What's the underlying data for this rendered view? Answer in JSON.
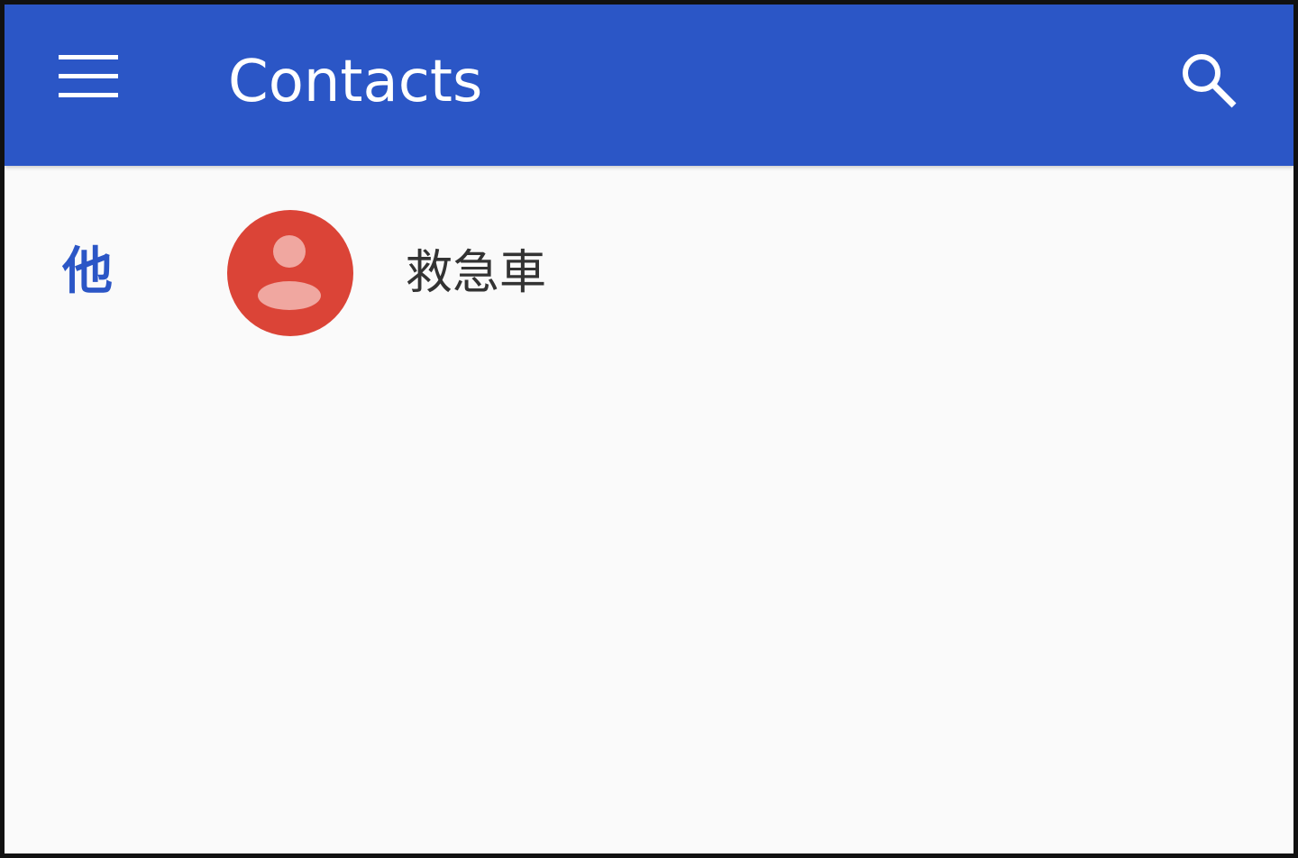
{
  "app_bar": {
    "title": "Contacts",
    "menu_icon": "hamburger-menu-icon",
    "search_icon": "search-icon",
    "background_color": "#2b56c6",
    "foreground_color": "#ffffff"
  },
  "contacts": {
    "sections": [
      {
        "header": "他",
        "header_color": "#2b56c6",
        "items": [
          {
            "name": "救急車",
            "avatar_icon": "person-avatar-icon",
            "avatar_color": "#db4437"
          }
        ]
      }
    ]
  }
}
